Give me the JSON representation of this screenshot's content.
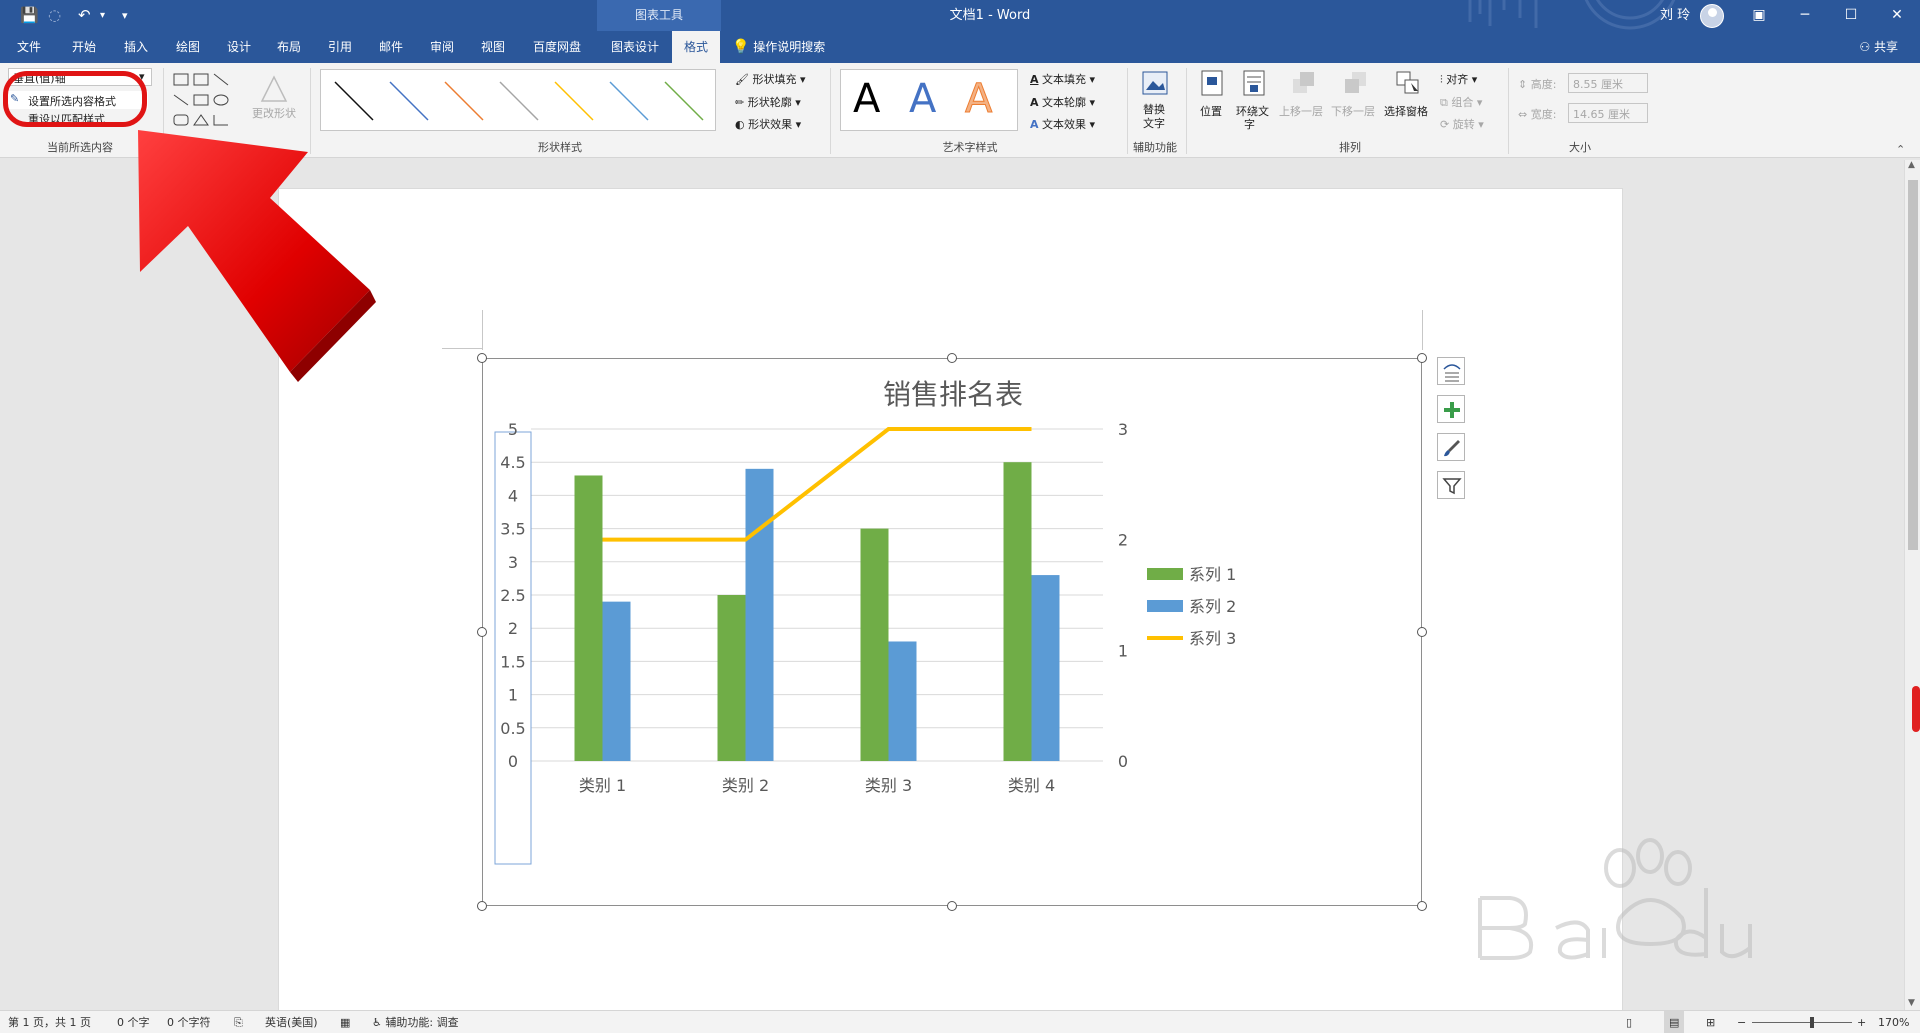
{
  "titlebar": {
    "context_tab": "图表工具",
    "doc_title": "文档1  -  Word",
    "user": "刘 玲",
    "min_icon": "─",
    "max_icon": "☐",
    "close_icon": "✕",
    "ribbon_display_icon": "▣",
    "save_icon": "💾",
    "undo_icon": "↶",
    "redo_icon": "↻",
    "customize_icon": "▾"
  },
  "tabs": [
    "文件",
    "开始",
    "插入",
    "绘图",
    "设计",
    "布局",
    "引用",
    "邮件",
    "审阅",
    "视图",
    "百度网盘",
    "图表设计",
    "格式"
  ],
  "tell_me": "操作说明搜索",
  "share": "共享",
  "ribbon": {
    "current_selection": {
      "dropdown_value": "垂直(值)轴",
      "format_selection": "设置所选内容格式",
      "reset_style": "重设以匹配样式",
      "label": "当前所选内容"
    },
    "insert_shapes": {
      "change_shape": "更改形状"
    },
    "shape_styles": {
      "fill": "形状填充",
      "outline": "形状轮廓",
      "effects": "形状效果",
      "label": "形状样式",
      "line_colors": [
        "#111111",
        "#4472c4",
        "#ed7d31",
        "#a5a5a5",
        "#ffc000",
        "#5b9bd5",
        "#70ad47"
      ]
    },
    "wordart": {
      "letter": "A",
      "text_fill": "文本填充",
      "text_outline": "文本轮廓",
      "text_effects": "文本效果",
      "label": "艺术字样式"
    },
    "accessibility": {
      "alt_text_1": "替换",
      "alt_text_2": "文字",
      "label": "辅助功能"
    },
    "arrange": {
      "position": "位置",
      "wrap_1": "环绕文",
      "wrap_2": "字",
      "bring_forward": "上移一层",
      "send_backward": "下移一层",
      "selection_pane": "选择窗格",
      "align": "对齐",
      "group": "组合",
      "rotate": "旋转",
      "label": "排列"
    },
    "size": {
      "height_label": "高度:",
      "height_value": "8.55 厘米",
      "width_label": "宽度:",
      "width_value": "14.65 厘米",
      "label": "大小"
    }
  },
  "chart_data": {
    "type": "bar",
    "title": "销售排名表",
    "categories": [
      "类别 1",
      "类别 2",
      "类别 3",
      "类别 4"
    ],
    "series": [
      {
        "name": "系列 1",
        "type": "bar",
        "axis": "primary",
        "values": [
          4.3,
          2.5,
          3.5,
          4.5
        ],
        "color": "#70ad47"
      },
      {
        "name": "系列 2",
        "type": "bar",
        "axis": "primary",
        "values": [
          2.4,
          4.4,
          1.8,
          2.8
        ],
        "color": "#5b9bd5"
      },
      {
        "name": "系列 3",
        "type": "line",
        "axis": "secondary",
        "values": [
          2,
          2,
          3,
          3
        ],
        "color": "#ffc000"
      }
    ],
    "ylim": [
      0,
      5
    ],
    "yticks": [
      "0",
      "0.5",
      "1",
      "1.5",
      "2",
      "2.5",
      "3",
      "3.5",
      "4",
      "4.5",
      "5"
    ],
    "y2lim": [
      0,
      3
    ],
    "y2ticks": [
      "0",
      "1",
      "2",
      "3"
    ],
    "grid": true,
    "legend": "right"
  },
  "status": {
    "page": "第 1 页，共 1 页",
    "words": "0 个字",
    "chars": "0 个字符",
    "language": "英语(美国)",
    "accessibility": "辅助功能: 调查",
    "zoom": "170%"
  }
}
